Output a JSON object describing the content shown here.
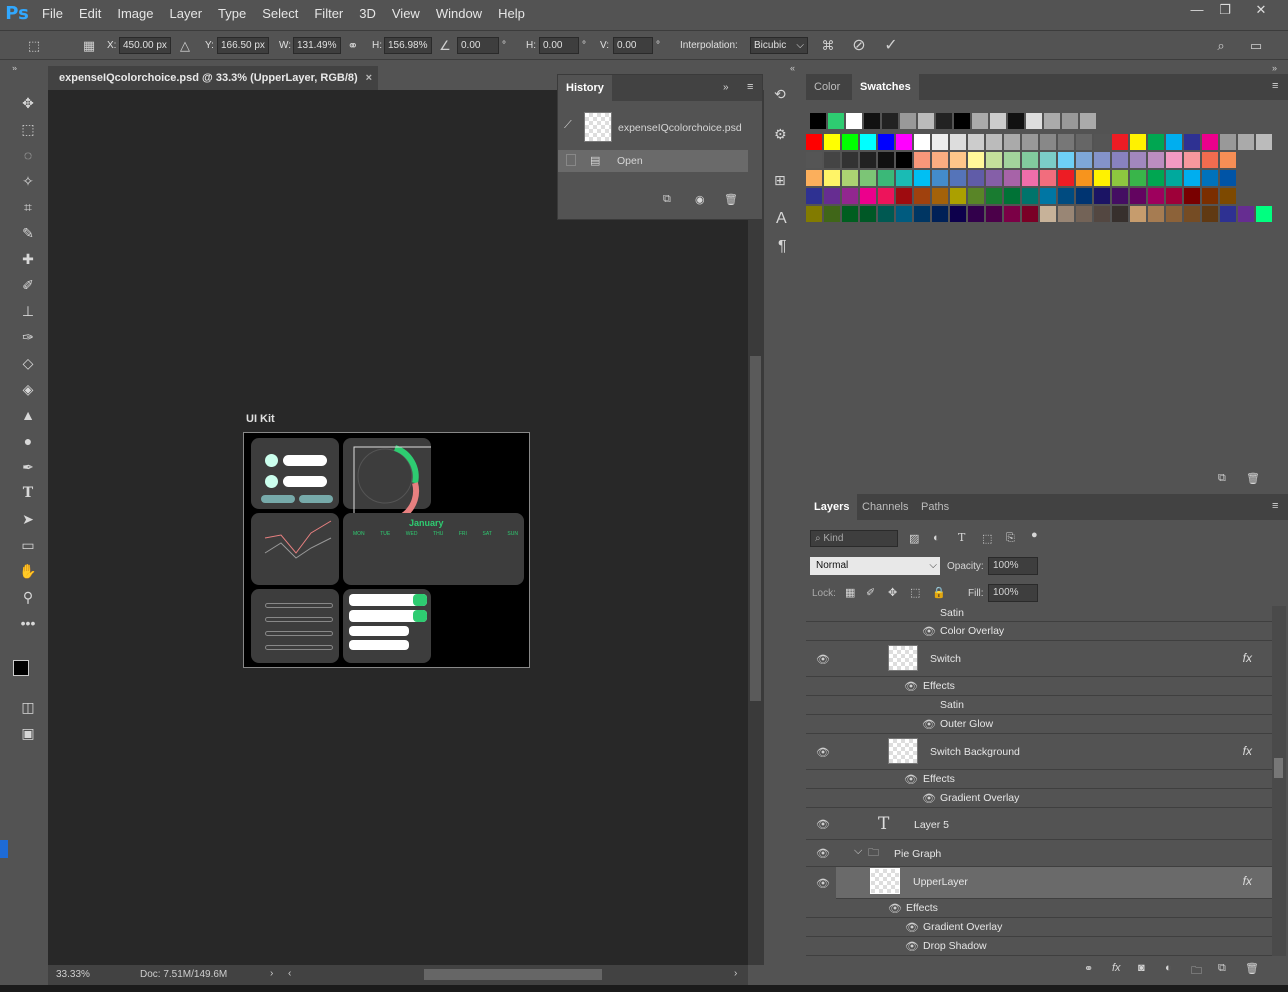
{
  "app": {
    "logo": "Ps"
  },
  "menu": [
    "File",
    "Edit",
    "Image",
    "Layer",
    "Type",
    "Select",
    "Filter",
    "3D",
    "View",
    "Window",
    "Help"
  ],
  "options": {
    "x_label": "X:",
    "x": "450.00 px",
    "y_label": "Y:",
    "y": "166.50 px",
    "w_label": "W:",
    "w": "131.49%",
    "h_label": "H:",
    "h": "156.98%",
    "angle": "0.00",
    "deg": "°",
    "hskew_label": "H:",
    "hskew": "0.00",
    "vskew_label": "V:",
    "vskew": "0.00",
    "interp_label": "Interpolation:",
    "interp": "Bicubic"
  },
  "document": {
    "tab": "expenseIQcolorchoice.psd @ 33.3% (UpperLayer, RGB/8)",
    "close": "×",
    "artboard": "UI Kit",
    "calendar_month": "January",
    "cal_days": [
      "MON",
      "TUE",
      "WED",
      "THU",
      "FRI",
      "SAT",
      "SUN"
    ]
  },
  "status": {
    "zoom": "33.33%",
    "doc": "Doc: 7.51M/149.6M"
  },
  "history": {
    "title": "History",
    "snapshot": "expenseIQcolorchoice.psd",
    "step": "Open"
  },
  "colorpanel": {
    "tab_color": "Color",
    "tab_swatches": "Swatches"
  },
  "layers": {
    "tab_layers": "Layers",
    "tab_channels": "Channels",
    "tab_paths": "Paths",
    "kind": "Kind",
    "blend": "Normal",
    "opacity_label": "Opacity:",
    "opacity": "100%",
    "lock_label": "Lock:",
    "fill_label": "Fill:",
    "fill": "100%",
    "rows": {
      "satin1": "Satin",
      "coloroverlay": "Color Overlay",
      "switch": "Switch",
      "effects1": "Effects",
      "satin2": "Satin",
      "outerglow": "Outer Glow",
      "switchbg": "Switch Background",
      "effects2": "Effects",
      "gradoverlay1": "Gradient Overlay",
      "layer5": "Layer 5",
      "piegraph": "Pie Graph",
      "upperlayer": "UpperLayer",
      "effects3": "Effects",
      "gradoverlay2": "Gradient Overlay",
      "dropshadow": "Drop Shadow"
    },
    "fx": "fx"
  },
  "colors": {
    "accent": "#31a8ff",
    "green": "#2ecc71",
    "pink": "#e88080"
  }
}
